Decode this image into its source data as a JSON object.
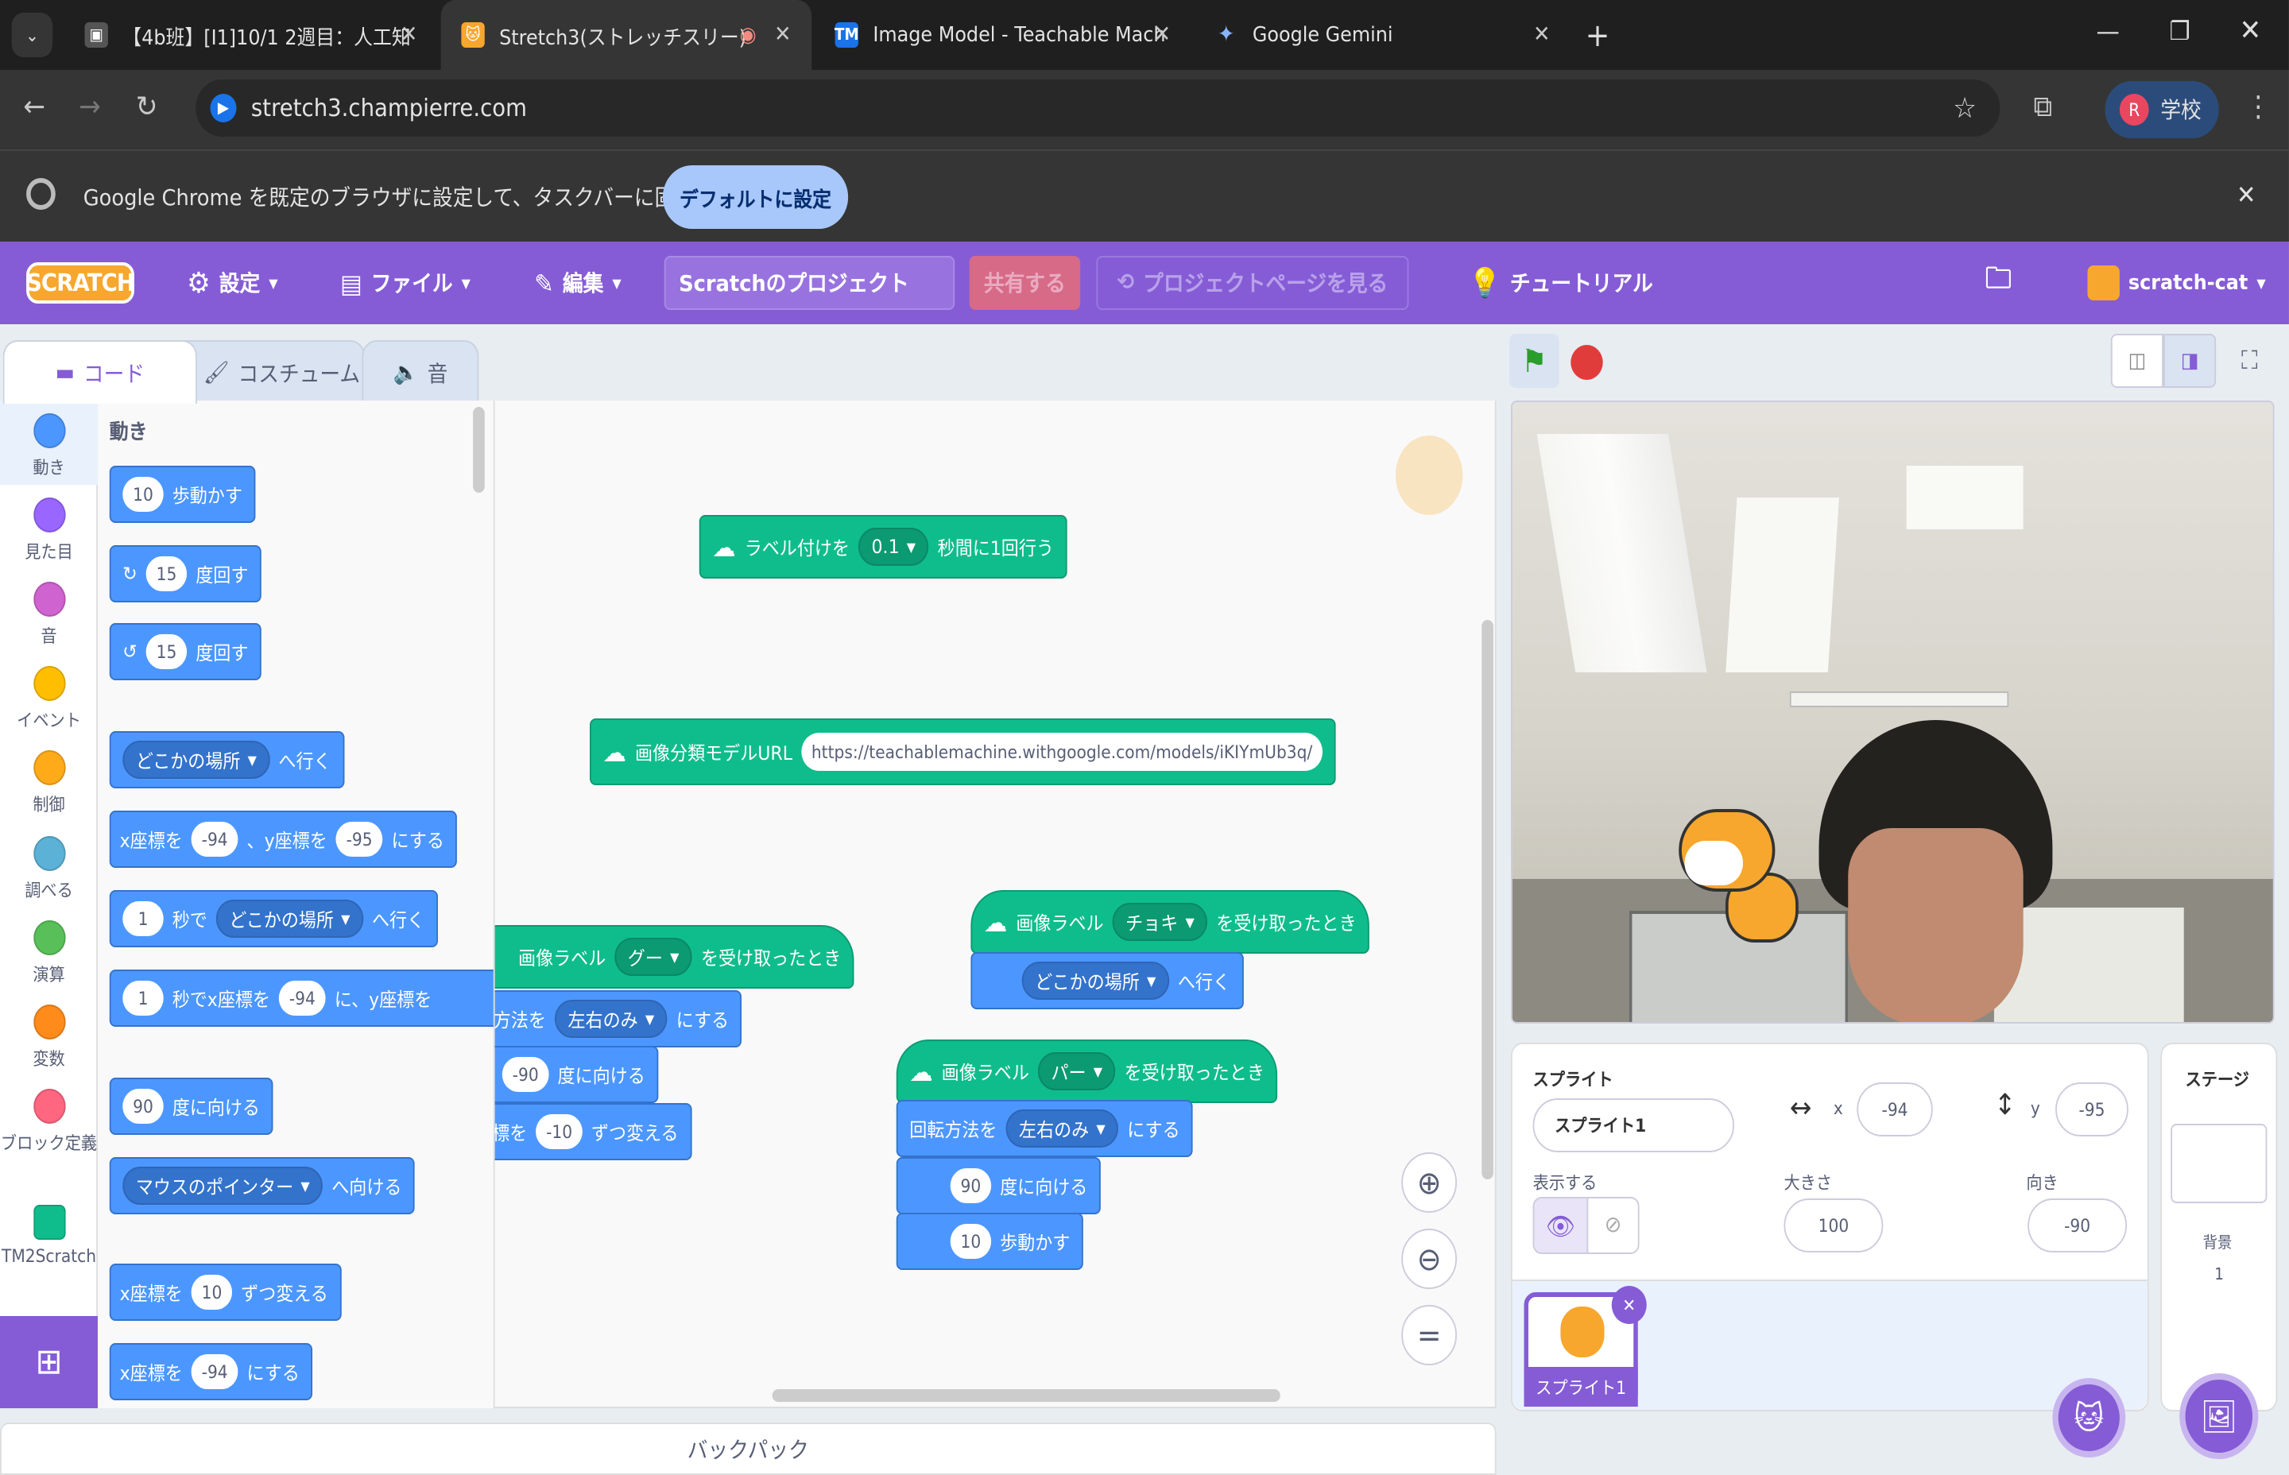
{
  "browser": {
    "tabs": [
      {
        "title": "【4b班】[I1]10/1 2週目：人工知"
      },
      {
        "title": "Stretch3(ストレッチスリー)"
      },
      {
        "title": "Image Model - Teachable Mach"
      },
      {
        "title": "Google Gemini"
      }
    ],
    "url": "stretch3.champierre.com",
    "profile_initial": "R",
    "profile_label": "学校",
    "infobar_text": "Google Chrome を既定のブラウザに設定して、タスクバーに固定する",
    "infobar_button": "デフォルトに設定"
  },
  "menu": {
    "logo": "SCRATCH",
    "settings": "設定",
    "file": "ファイル",
    "edit": "編集",
    "project_title": "Scratchのプロジェクト",
    "share": "共有する",
    "see_project": "プロジェクトページを見る",
    "tutorial": "チュートリアル",
    "username": "scratch-cat"
  },
  "editor_tabs": {
    "code": "コード",
    "costumes": "コスチューム",
    "sounds": "音"
  },
  "categories": [
    {
      "label": "動き",
      "color": "#4c97ff"
    },
    {
      "label": "見た目",
      "color": "#9966ff"
    },
    {
      "label": "音",
      "color": "#cf63cf"
    },
    {
      "label": "イベント",
      "color": "#ffbf00"
    },
    {
      "label": "制御",
      "color": "#ffab19"
    },
    {
      "label": "調べる",
      "color": "#5cb1d6"
    },
    {
      "label": "演算",
      "color": "#59c059"
    },
    {
      "label": "変数",
      "color": "#ff8c1a"
    },
    {
      "label": "ブロック定義",
      "color": "#ff6680"
    },
    {
      "label": "TM2Scratch",
      "color": "#0fbd8c"
    }
  ],
  "palette": {
    "heading": "動き",
    "move_steps": "10",
    "move_label": "歩動かす",
    "turn_r": "15",
    "turn_l": "15",
    "turn_label": "度回す",
    "goto_dd": "どこかの場所",
    "goto_label": "へ行く",
    "gotoxy_x_label": "x座標を",
    "gotoxy_x": "-94",
    "gotoxy_y_label": "、y座標を",
    "gotoxy_y": "-95",
    "gotoxy_end": "にする",
    "glide_secs": "1",
    "glide_secs_label": "秒で",
    "glide_dd": "どこかの場所",
    "glide_end": "へ行く",
    "glidexy_secs": "1",
    "glidexy_label": "秒でx座標を",
    "glidexy_x": "-94",
    "glidexy_y_label": "に、y座標を",
    "point_deg": "90",
    "point_label": "度に向ける",
    "pointto_dd": "マウスのポインター",
    "pointto_label": "へ向ける",
    "changex_label": "x座標を",
    "changex_val": "10",
    "changex_end": "ずつ変える",
    "setx_label": "x座標を",
    "setx_val": "-94",
    "setx_end": "にする"
  },
  "workspace": {
    "labeling_pre": "ラベル付けを",
    "labeling_val": "0.1",
    "labeling_post": "秒間に1回行う",
    "url_label": "画像分類モデルURL",
    "url_value": "https://teachablemachine.withgoogle.com/models/iKIYmUb3q/",
    "when_label_pre": "画像ラベル",
    "when_label_post": "を受け取ったとき",
    "goo": "グー",
    "choki": "チョキ",
    "paa": "パー",
    "s1_rot_pre": "方法を",
    "s1_rot_dd": "左右のみ",
    "s1_rot_post": "にする",
    "s1_point_val": "-90",
    "s1_point_label": "度に向ける",
    "s1_changex_label": "x座標を",
    "s1_changex_val": "-10",
    "s1_changex_end": "ずつ変える",
    "s2_goto_dd": "どこかの場所",
    "s2_goto_label": "へ行く",
    "s3_rot_pre": "回転方法を",
    "s3_rot_dd": "左右のみ",
    "s3_rot_post": "にする",
    "s3_point_val": "90",
    "s3_point_label": "度に向ける",
    "s3_move_val": "10",
    "s3_move_label": "歩動かす"
  },
  "backpack": "バックパック",
  "sprite_info": {
    "heading": "スプライト",
    "name": "スプライト1",
    "x_label": "x",
    "x": "-94",
    "y_label": "y",
    "y": "-95",
    "show_label": "表示する",
    "size_label": "大きさ",
    "size": "100",
    "direction_label": "向き",
    "direction": "-90",
    "thumb_label": "スプライト1"
  },
  "stage_pane": {
    "heading": "ステージ",
    "backdrops_label": "背景",
    "backdrops_count": "1"
  }
}
